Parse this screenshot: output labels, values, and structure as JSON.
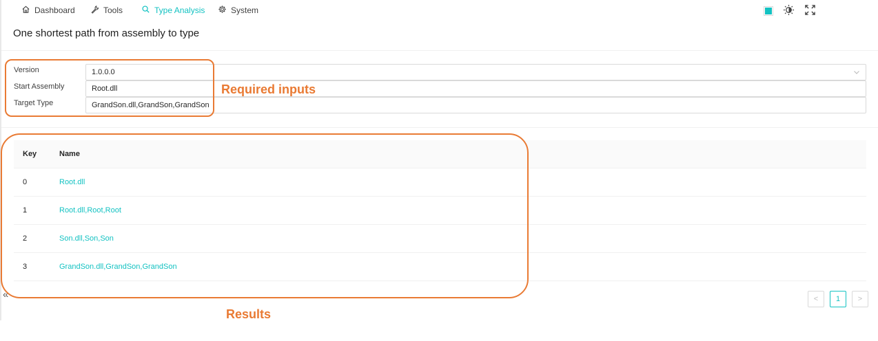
{
  "nav": {
    "items": [
      {
        "label": "Dashboard",
        "icon": "home-icon"
      },
      {
        "label": "Tools",
        "icon": "wrench-icon"
      },
      {
        "label": "Type Analysis",
        "icon": "search-icon",
        "active": true
      },
      {
        "label": "System",
        "icon": "gear-icon"
      }
    ]
  },
  "accent_color": "#13c2c2",
  "annotation_color": "#e97a33",
  "page": {
    "title": "One shortest path from assembly to type"
  },
  "form": {
    "version": {
      "label": "Version",
      "value": "1.0.0.0"
    },
    "start_assembly": {
      "label": "Start Assembly",
      "value": "Root.dll"
    },
    "target_type": {
      "label": "Target Type",
      "value": "GrandSon.dll,GrandSon,GrandSon"
    }
  },
  "table": {
    "columns": [
      "Key",
      "Name"
    ],
    "rows": [
      {
        "key": "0",
        "name": "Root.dll"
      },
      {
        "key": "1",
        "name": "Root.dll,Root,Root"
      },
      {
        "key": "2",
        "name": "Son.dll,Son,Son"
      },
      {
        "key": "3",
        "name": "GrandSon.dll,GrandSon,GrandSon"
      }
    ]
  },
  "pagination": {
    "prev": "<",
    "current": "1",
    "next": ">"
  },
  "sidebar": {
    "collapse": "«"
  },
  "annotations": {
    "inputs": "Required inputs",
    "results": "Results"
  }
}
